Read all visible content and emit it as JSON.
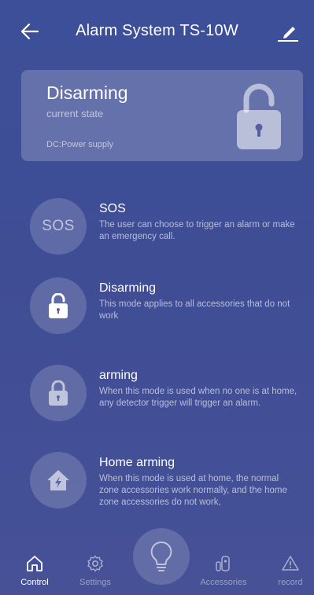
{
  "header": {
    "title": "Alarm System TS-10W",
    "back_icon": "arrow-left-icon",
    "edit_icon": "pencil-icon"
  },
  "status": {
    "state": "Disarming",
    "state_caption": "current state",
    "power": "DC:Power supply",
    "icon": "unlocked-padlock-icon"
  },
  "modes": [
    {
      "title": "SOS",
      "icon_text": "SOS",
      "description": "The user can choose to trigger an alarm or make an emergency call."
    },
    {
      "title": "Disarming",
      "description": "This mode applies to all accessories that do not work"
    },
    {
      "title": "arming",
      "description": "When this mode is used when no one is at home, any detector trigger will trigger an alarm."
    },
    {
      "title": "Home arming",
      "description": "When this mode is used at home, the normal zone accessories work normally, and the home zone accessories do not work,"
    }
  ],
  "nav": [
    {
      "label": "Control",
      "icon": "home-icon",
      "active": true
    },
    {
      "label": "Settings",
      "icon": "gear-icon",
      "active": false
    },
    {
      "label": "Accessories",
      "icon": "sensor-icon",
      "active": false
    },
    {
      "label": "record",
      "icon": "warning-icon",
      "active": false
    }
  ],
  "center_button_icon": "lightbulb-icon",
  "colors": {
    "background_top": "#3d4f98",
    "background_bottom": "#465196",
    "text": "#ffffff"
  }
}
